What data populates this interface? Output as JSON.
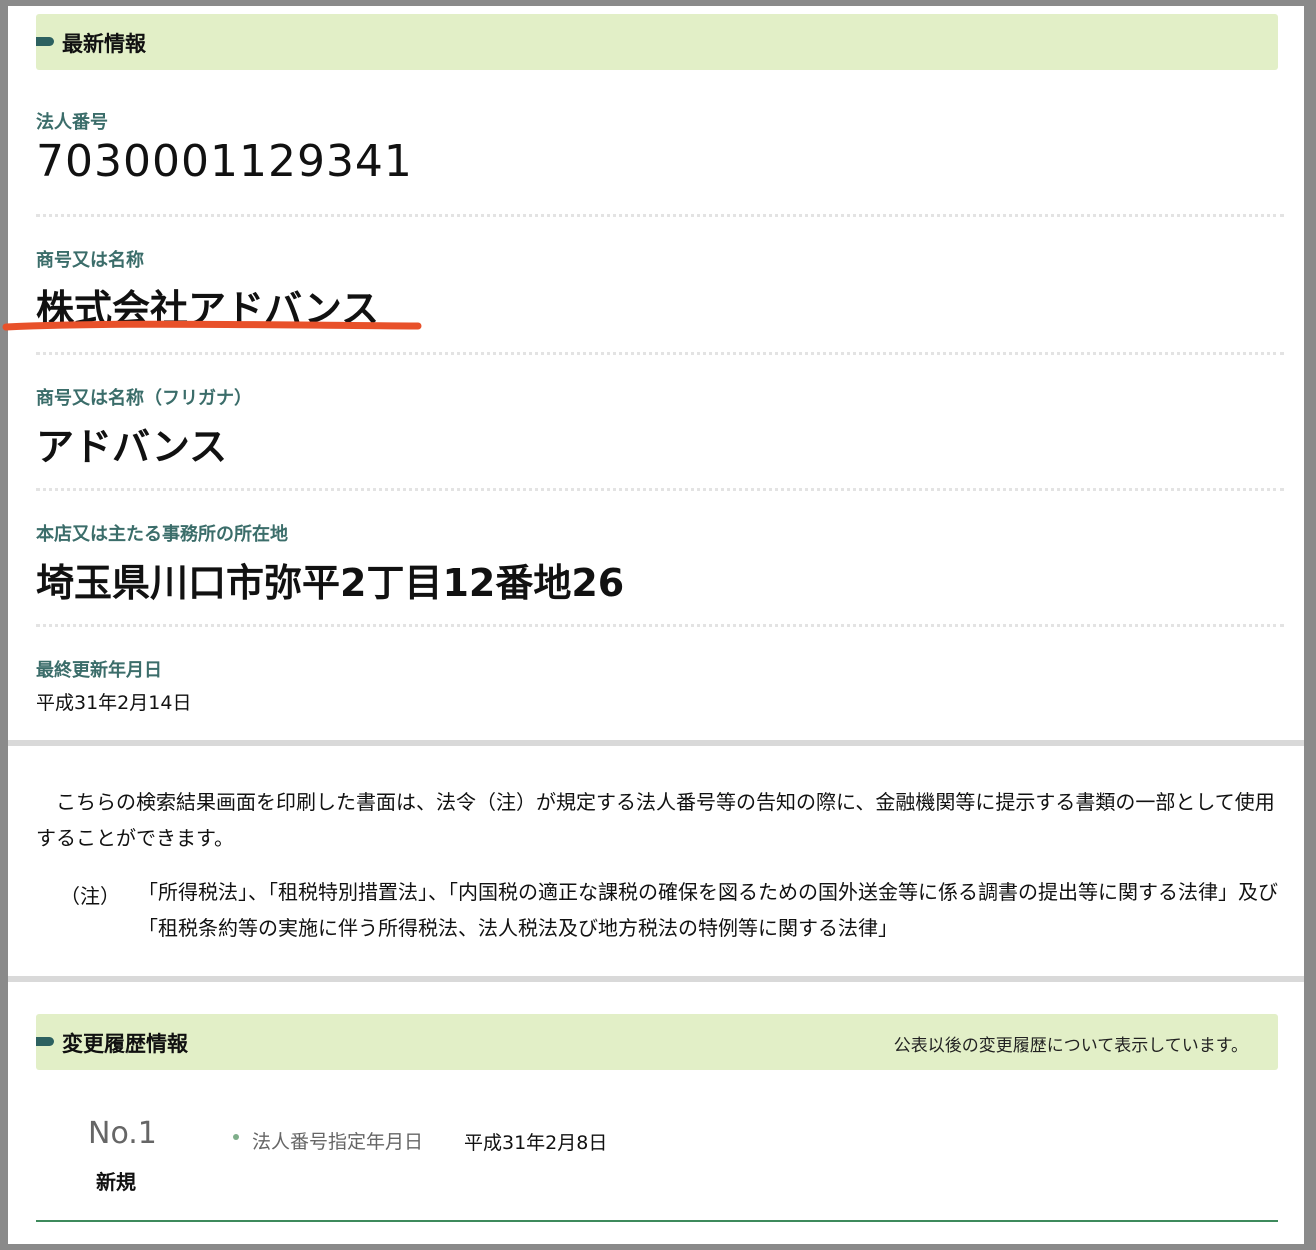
{
  "latest": {
    "section_title": "最新情報",
    "corp_number_label": "法人番号",
    "corp_number": "7030001129341",
    "name_label": "商号又は名称",
    "name": "株式会社アドバンス",
    "furigana_label": "商号又は名称（フリガナ）",
    "furigana": "アドバンス",
    "address_label": "本店又は主たる事務所の所在地",
    "address": "埼玉県川口市弥平2丁目12番地26",
    "updated_label": "最終更新年月日",
    "updated": "平成31年2月14日"
  },
  "notice": {
    "paragraph": "　こちらの検索結果画面を印刷した書面は、法令（注）が規定する法人番号等の告知の際に、金融機関等に提示する書類の一部として使用することができます。",
    "note_mark": "（注）",
    "note_text": "「所得税法」、「租税特別措置法」、「内国税の適正な課税の確保を図るための国外送金等に係る調書の提出等に関する法律」及び「租税条約等の実施に伴う所得税法、法人税法及び地方税法の特例等に関する法律」"
  },
  "history": {
    "section_title": "変更履歴情報",
    "section_note": "公表以後の変更履歴について表示しています。",
    "entries": [
      {
        "number": "No.1",
        "kind": "新規",
        "field_label": "法人番号指定年月日",
        "field_value": "平成31年2月8日"
      }
    ]
  },
  "colors": {
    "header_bg": "#e2efc7",
    "label_color": "#3b6d6a",
    "highlight_underline": "#e8512a"
  }
}
